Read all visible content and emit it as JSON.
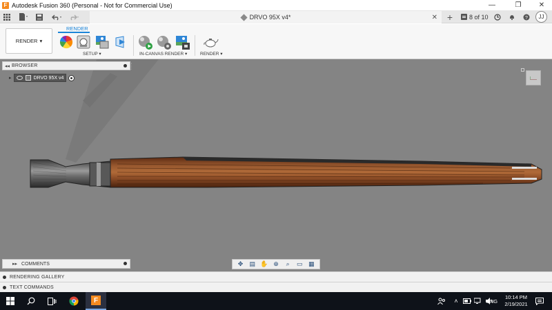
{
  "window": {
    "title": "Autodesk Fusion 360 (Personal - Not for Commercial Use)",
    "app_icon_letter": "F",
    "minimize_glyph": "—",
    "maximize_glyph": "❐",
    "close_glyph": "✕"
  },
  "appbar": {
    "document_title": "DRVO 95X v4*",
    "job_status": "8 of 10",
    "user_initials": "JJ",
    "new_tab_glyph": "+",
    "tab_close_glyph": "✕"
  },
  "toolbar": {
    "workspace_label": "RENDER",
    "workspace_caret": "▾",
    "active_tab": "RENDER",
    "groups": [
      {
        "label": "SETUP ▾"
      },
      {
        "label": "IN-CANVAS RENDER ▾"
      },
      {
        "label": "RENDER ▾"
      }
    ]
  },
  "browser": {
    "header": "BROWSER",
    "collapse_glyph": "◂◂",
    "root_node": "DRVO 95X v4",
    "expand_glyph": "▸"
  },
  "comments": {
    "header": "COMMENTS",
    "collapse_glyph": "▸▸"
  },
  "bottom_panels": [
    {
      "label": "RENDERING GALLERY"
    },
    {
      "label": "TEXT COMMANDS"
    }
  ],
  "taskbar": {
    "time": "10:14 PM",
    "date": "2/19/2021",
    "language": "ENG",
    "app_letter": "F"
  },
  "colors": {
    "viewport_bg": "#848484",
    "accent": "#1a84d8",
    "wood": "#8b4a24",
    "taskbar_bg": "#0e1219",
    "fusion_orange": "#f58a1f"
  },
  "icons": [
    "grid-icon",
    "file-icon",
    "save-icon",
    "undo-icon",
    "redo-icon",
    "appearance-icon",
    "scene-settings-icon",
    "texture-map-icon",
    "decal-icon",
    "in-canvas-render-icon",
    "in-canvas-settings-icon",
    "capture-image-icon",
    "render-teapot-icon",
    "orbit-icon",
    "look-at-icon",
    "pan-icon",
    "zoom-icon",
    "fit-icon",
    "display-settings-icon",
    "grid-settings-icon",
    "windows-start-icon",
    "search-icon",
    "task-view-icon",
    "chrome-icon",
    "fusion-icon",
    "people-icon",
    "chevron-up-icon",
    "network-icon",
    "volume-icon",
    "notification-icon"
  ]
}
